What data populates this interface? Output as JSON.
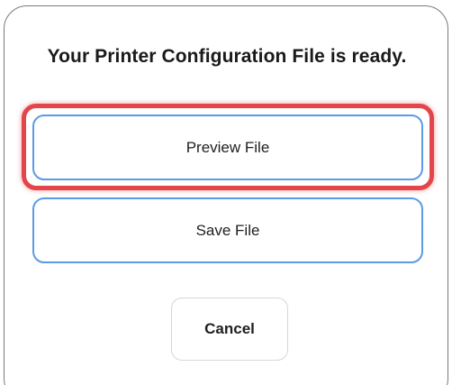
{
  "dialog": {
    "title": "Your Printer Configuration File is ready.",
    "buttons": {
      "preview_label": "Preview File",
      "save_label": "Save File",
      "cancel_label": "Cancel"
    },
    "highlight_color": "#e2454a",
    "button_border_color": "#5a9be6"
  }
}
